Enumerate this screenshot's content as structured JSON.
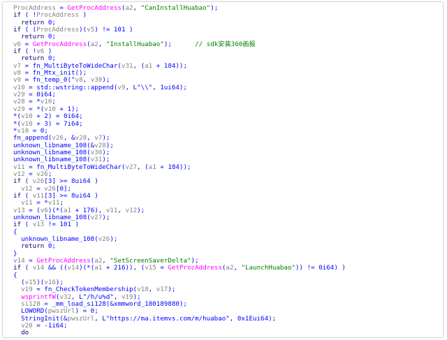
{
  "colors": {
    "background": "#ffffff",
    "default": "#0000ff",
    "black": "#000080",
    "var": "#808080",
    "api": "#ff00ff",
    "str": "#008000",
    "cmt": "#008000"
  },
  "lines": [
    [
      [
        "var",
        "ProcAddress"
      ],
      [
        "default",
        " = "
      ],
      [
        "api",
        "GetProcAddress"
      ],
      [
        "default",
        "("
      ],
      [
        "var",
        "a2"
      ],
      [
        "default",
        ", "
      ],
      [
        "str",
        "\"CanInstallHuabao\""
      ],
      [
        "default",
        ");"
      ]
    ],
    [
      [
        "black",
        "if"
      ],
      [
        "default",
        " ( !"
      ],
      [
        "var",
        "ProcAddress"
      ],
      [
        "default",
        " )"
      ]
    ],
    [
      [
        "default",
        "  "
      ],
      [
        "black",
        "return"
      ],
      [
        "default",
        " 0;"
      ]
    ],
    [
      [
        "black",
        "if"
      ],
      [
        "default",
        " ( ("
      ],
      [
        "var",
        "ProcAddress"
      ],
      [
        "default",
        ")("
      ],
      [
        "var",
        "v5"
      ],
      [
        "default",
        ") != 101 )"
      ]
    ],
    [
      [
        "default",
        "  "
      ],
      [
        "black",
        "return"
      ],
      [
        "default",
        " 0;"
      ]
    ],
    [
      [
        "var",
        "v6"
      ],
      [
        "default",
        " = "
      ],
      [
        "api",
        "GetProcAddress"
      ],
      [
        "default",
        "("
      ],
      [
        "var",
        "a2"
      ],
      [
        "default",
        ", "
      ],
      [
        "str",
        "\"InstallHuabao\""
      ],
      [
        "default",
        ");      "
      ],
      [
        "cmt",
        "// sdk安装360画报"
      ]
    ],
    [
      [
        "black",
        "if"
      ],
      [
        "default",
        " ( !"
      ],
      [
        "var",
        "v6"
      ],
      [
        "default",
        " )"
      ]
    ],
    [
      [
        "default",
        "  "
      ],
      [
        "black",
        "return"
      ],
      [
        "default",
        " 0;"
      ]
    ],
    [
      [
        "var",
        "v7"
      ],
      [
        "default",
        " = fn_MultiByteToWideChar("
      ],
      [
        "var",
        "v31"
      ],
      [
        "default",
        ", ("
      ],
      [
        "var",
        "a1"
      ],
      [
        "default",
        " + 184));"
      ]
    ],
    [
      [
        "var",
        "v8"
      ],
      [
        "default",
        " = fn_Mtx_init();"
      ]
    ],
    [
      [
        "var",
        "v9"
      ],
      [
        "default",
        " = fn_temp_0(\""
      ],
      [
        "var",
        "v8"
      ],
      [
        "default",
        ", "
      ],
      [
        "var",
        "v30"
      ],
      [
        "default",
        ");"
      ]
    ],
    [
      [
        "var",
        "v10"
      ],
      [
        "default",
        " = std::wstring::append("
      ],
      [
        "var",
        "v9"
      ],
      [
        "default",
        ", L\"\\\\\", 1ui64);"
      ]
    ],
    [
      [
        "var",
        "v29"
      ],
      [
        "default",
        " = 0i64;"
      ]
    ],
    [
      [
        "var",
        "v28"
      ],
      [
        "default",
        " = *"
      ],
      [
        "var",
        "v10"
      ],
      [
        "default",
        ";"
      ]
    ],
    [
      [
        "var",
        "v29"
      ],
      [
        "default",
        " = *("
      ],
      [
        "var",
        "v10"
      ],
      [
        "default",
        " + 1);"
      ]
    ],
    [
      [
        "default",
        "*("
      ],
      [
        "var",
        "v10"
      ],
      [
        "default",
        " + 2) = 0i64;"
      ]
    ],
    [
      [
        "default",
        "*("
      ],
      [
        "var",
        "v10"
      ],
      [
        "default",
        " + 3) = 7i64;"
      ]
    ],
    [
      [
        "default",
        "*"
      ],
      [
        "var",
        "v10"
      ],
      [
        "default",
        " = 0;"
      ]
    ],
    [
      [
        "default",
        "fn_append("
      ],
      [
        "var",
        "v26"
      ],
      [
        "default",
        ", &"
      ],
      [
        "var",
        "v28"
      ],
      [
        "default",
        ", "
      ],
      [
        "var",
        "v7"
      ],
      [
        "default",
        ");"
      ]
    ],
    [
      [
        "default",
        "unknown_libname_108(&"
      ],
      [
        "var",
        "v28"
      ],
      [
        "default",
        ");"
      ]
    ],
    [
      [
        "default",
        "unknown_libname_108("
      ],
      [
        "var",
        "v30"
      ],
      [
        "default",
        ");"
      ]
    ],
    [
      [
        "default",
        "unknown_libname_108("
      ],
      [
        "var",
        "v31"
      ],
      [
        "default",
        ");"
      ]
    ],
    [
      [
        "var",
        "v11"
      ],
      [
        "default",
        " = fn_MultiByteToWideChar("
      ],
      [
        "var",
        "v27"
      ],
      [
        "default",
        ", ("
      ],
      [
        "var",
        "a1"
      ],
      [
        "default",
        " + 184));"
      ]
    ],
    [
      [
        "var",
        "v12"
      ],
      [
        "default",
        " = "
      ],
      [
        "var",
        "v26"
      ],
      [
        "default",
        ";"
      ]
    ],
    [
      [
        "black",
        "if"
      ],
      [
        "default",
        " ( "
      ],
      [
        "var",
        "v26"
      ],
      [
        "default",
        "[3] >= 8ui64 )"
      ]
    ],
    [
      [
        "default",
        "  "
      ],
      [
        "var",
        "v12"
      ],
      [
        "default",
        " = "
      ],
      [
        "var",
        "v26"
      ],
      [
        "default",
        "[0];"
      ]
    ],
    [
      [
        "black",
        "if"
      ],
      [
        "default",
        " ( "
      ],
      [
        "var",
        "v11"
      ],
      [
        "default",
        "[3] >= 8ui64 )"
      ]
    ],
    [
      [
        "default",
        "  "
      ],
      [
        "var",
        "v11"
      ],
      [
        "default",
        " = *"
      ],
      [
        "var",
        "v11"
      ],
      [
        "default",
        ";"
      ]
    ],
    [
      [
        "var",
        "v13"
      ],
      [
        "default",
        " = ("
      ],
      [
        "var",
        "v6"
      ],
      [
        "default",
        ")(*("
      ],
      [
        "var",
        "a1"
      ],
      [
        "default",
        " + 176), "
      ],
      [
        "var",
        "v11"
      ],
      [
        "default",
        ", "
      ],
      [
        "var",
        "v12"
      ],
      [
        "default",
        ");"
      ]
    ],
    [
      [
        "default",
        "unknown_libname_108("
      ],
      [
        "var",
        "v27"
      ],
      [
        "default",
        ");"
      ]
    ],
    [
      [
        "black",
        "if"
      ],
      [
        "default",
        " ( "
      ],
      [
        "var",
        "v13"
      ],
      [
        "default",
        " != 101 )"
      ]
    ],
    [
      [
        "default",
        "{"
      ]
    ],
    [
      [
        "default",
        "  unknown_libname_108("
      ],
      [
        "var",
        "v26"
      ],
      [
        "default",
        ");"
      ]
    ],
    [
      [
        "default",
        "  "
      ],
      [
        "black",
        "return"
      ],
      [
        "default",
        " 0;"
      ]
    ],
    [
      [
        "default",
        "}"
      ]
    ],
    [
      [
        "var",
        "v14"
      ],
      [
        "default",
        " = "
      ],
      [
        "api",
        "GetProcAddress"
      ],
      [
        "default",
        "("
      ],
      [
        "var",
        "a2"
      ],
      [
        "default",
        ", "
      ],
      [
        "str",
        "\"SetScreenSaverDelta\""
      ],
      [
        "default",
        ");"
      ]
    ],
    [
      [
        "black",
        "if"
      ],
      [
        "default",
        " ( "
      ],
      [
        "var",
        "v14"
      ],
      [
        "default",
        " && (("
      ],
      [
        "var",
        "v14"
      ],
      [
        "default",
        ")(*("
      ],
      [
        "var",
        "a1"
      ],
      [
        "default",
        " + 216)), ("
      ],
      [
        "var",
        "v15"
      ],
      [
        "default",
        " = "
      ],
      [
        "api",
        "GetProcAddress"
      ],
      [
        "default",
        "("
      ],
      [
        "var",
        "a2"
      ],
      [
        "default",
        ", "
      ],
      [
        "str",
        "\"LaunchHuabao\""
      ],
      [
        "default",
        ")) != 0i64) )"
      ]
    ],
    [
      [
        "default",
        "{"
      ]
    ],
    [
      [
        "default",
        "  ("
      ],
      [
        "var",
        "v15"
      ],
      [
        "default",
        ")("
      ],
      [
        "var",
        "v16"
      ],
      [
        "default",
        ");"
      ]
    ],
    [
      [
        "default",
        "  "
      ],
      [
        "var",
        "v19"
      ],
      [
        "default",
        " = fn_CheckTokenMembership("
      ],
      [
        "var",
        "v18"
      ],
      [
        "default",
        ", "
      ],
      [
        "var",
        "v17"
      ],
      [
        "default",
        ");"
      ]
    ],
    [
      [
        "default",
        "  "
      ],
      [
        "api",
        "wsprintfW"
      ],
      [
        "default",
        "("
      ],
      [
        "var",
        "v32"
      ],
      [
        "default",
        ", L\"/h/u%d\", "
      ],
      [
        "var",
        "v19"
      ],
      [
        "default",
        ");"
      ]
    ],
    [
      [
        "default",
        "  "
      ],
      [
        "var",
        "si128"
      ],
      [
        "default",
        " = _mm_load_si128(&xmmword_180189880);"
      ]
    ],
    [
      [
        "default",
        "  LOWORD("
      ],
      [
        "var",
        "pwszUrl"
      ],
      [
        "default",
        ") = 0;"
      ]
    ],
    [
      [
        "default",
        "  StringInit(&"
      ],
      [
        "var",
        "pwszUrl"
      ],
      [
        "default",
        ", L\"https://ma.itemvs.com/m/huabao\", 0x1Eui64);"
      ]
    ],
    [
      [
        "default",
        "  "
      ],
      [
        "var",
        "v20"
      ],
      [
        "default",
        " = -1i64;"
      ]
    ],
    [
      [
        "default",
        "  "
      ],
      [
        "black",
        "do"
      ]
    ]
  ]
}
